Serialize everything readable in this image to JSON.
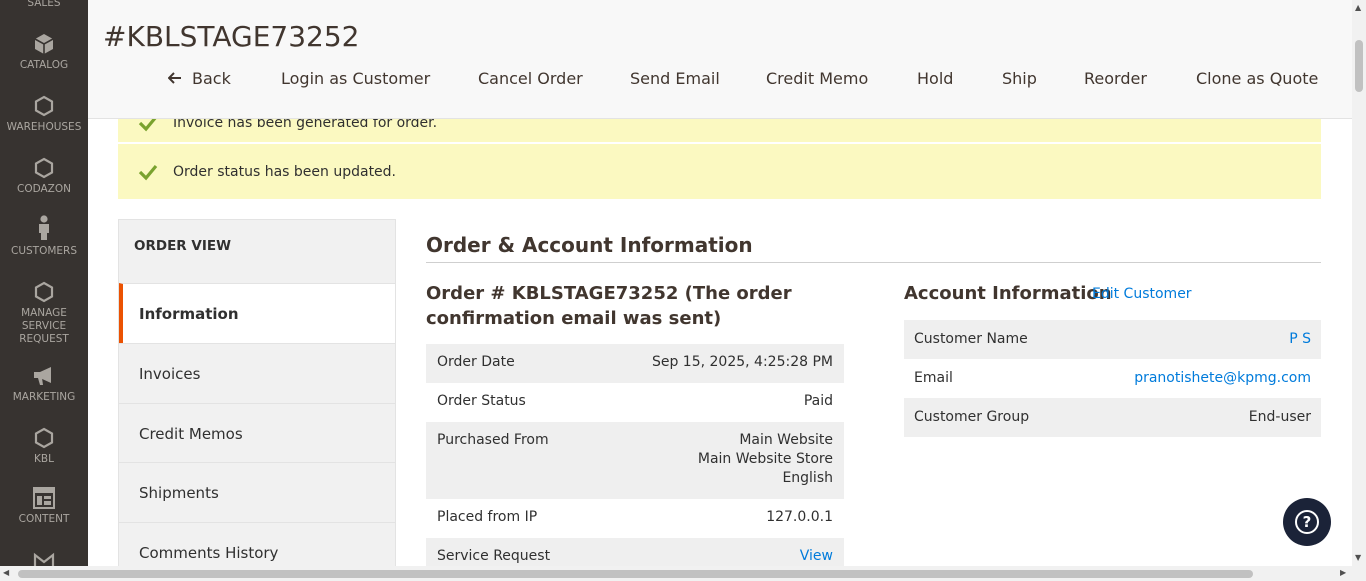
{
  "sidebar": {
    "items": [
      {
        "label": "SALES",
        "icon": "sales-icon"
      },
      {
        "label": "CATALOG",
        "icon": "catalog-cube-icon"
      },
      {
        "label": "WAREHOUSES",
        "icon": "hexagon-icon"
      },
      {
        "label": "CODAZON",
        "icon": "hexagon-icon"
      },
      {
        "label": "CUSTOMERS",
        "icon": "person-icon"
      },
      {
        "label": "MANAGE SERVICE REQUEST",
        "icon": "hexagon-icon"
      },
      {
        "label": "MARKETING",
        "icon": "megaphone-icon"
      },
      {
        "label": "KBL",
        "icon": "hexagon-icon"
      },
      {
        "label": "CONTENT",
        "icon": "content-layout-icon"
      }
    ]
  },
  "header": {
    "title": "#KBLSTAGE73252",
    "actions": {
      "back": "Back",
      "login_as_customer": "Login as Customer",
      "cancel_order": "Cancel Order",
      "send_email": "Send Email",
      "credit_memo": "Credit Memo",
      "hold": "Hold",
      "ship": "Ship",
      "reorder": "Reorder",
      "clone_as_quote": "Clone as Quote"
    }
  },
  "messages": {
    "invoice": "Invoice has been generated for order.",
    "status": "Order status has been updated."
  },
  "side_nav": {
    "title": "ORDER VIEW",
    "tabs": [
      "Information",
      "Invoices",
      "Credit Memos",
      "Shipments",
      "Comments History"
    ],
    "active": "Information"
  },
  "main": {
    "section_title": "Order & Account Information",
    "order_title": "Order # KBLSTAGE73252 (The order confirmation email was sent)",
    "order_rows": [
      {
        "key": "Order Date",
        "value": "Sep 15, 2025, 4:25:28 PM"
      },
      {
        "key": "Order Status",
        "value": "Paid"
      },
      {
        "key": "Purchased From",
        "value_lines": [
          "Main Website",
          "Main Website Store",
          "English"
        ]
      },
      {
        "key": "Placed from IP",
        "value": "127.0.0.1"
      },
      {
        "key": "Service Request",
        "value": "View"
      }
    ],
    "account": {
      "title": "Account Information",
      "edit_link": "Edit Customer",
      "rows": [
        {
          "key": "Customer Name",
          "value": "P S"
        },
        {
          "key": "Email",
          "value": "pranotishete@kpmg.com"
        },
        {
          "key": "Customer Group",
          "value": "End-user"
        }
      ]
    }
  },
  "help": {
    "label": "?"
  },
  "colors": {
    "sidebar_bg": "#373330",
    "accent": "#eb5202",
    "link": "#007bdb",
    "message_bg": "#fbf9c1",
    "success_check": "#79a22e"
  }
}
